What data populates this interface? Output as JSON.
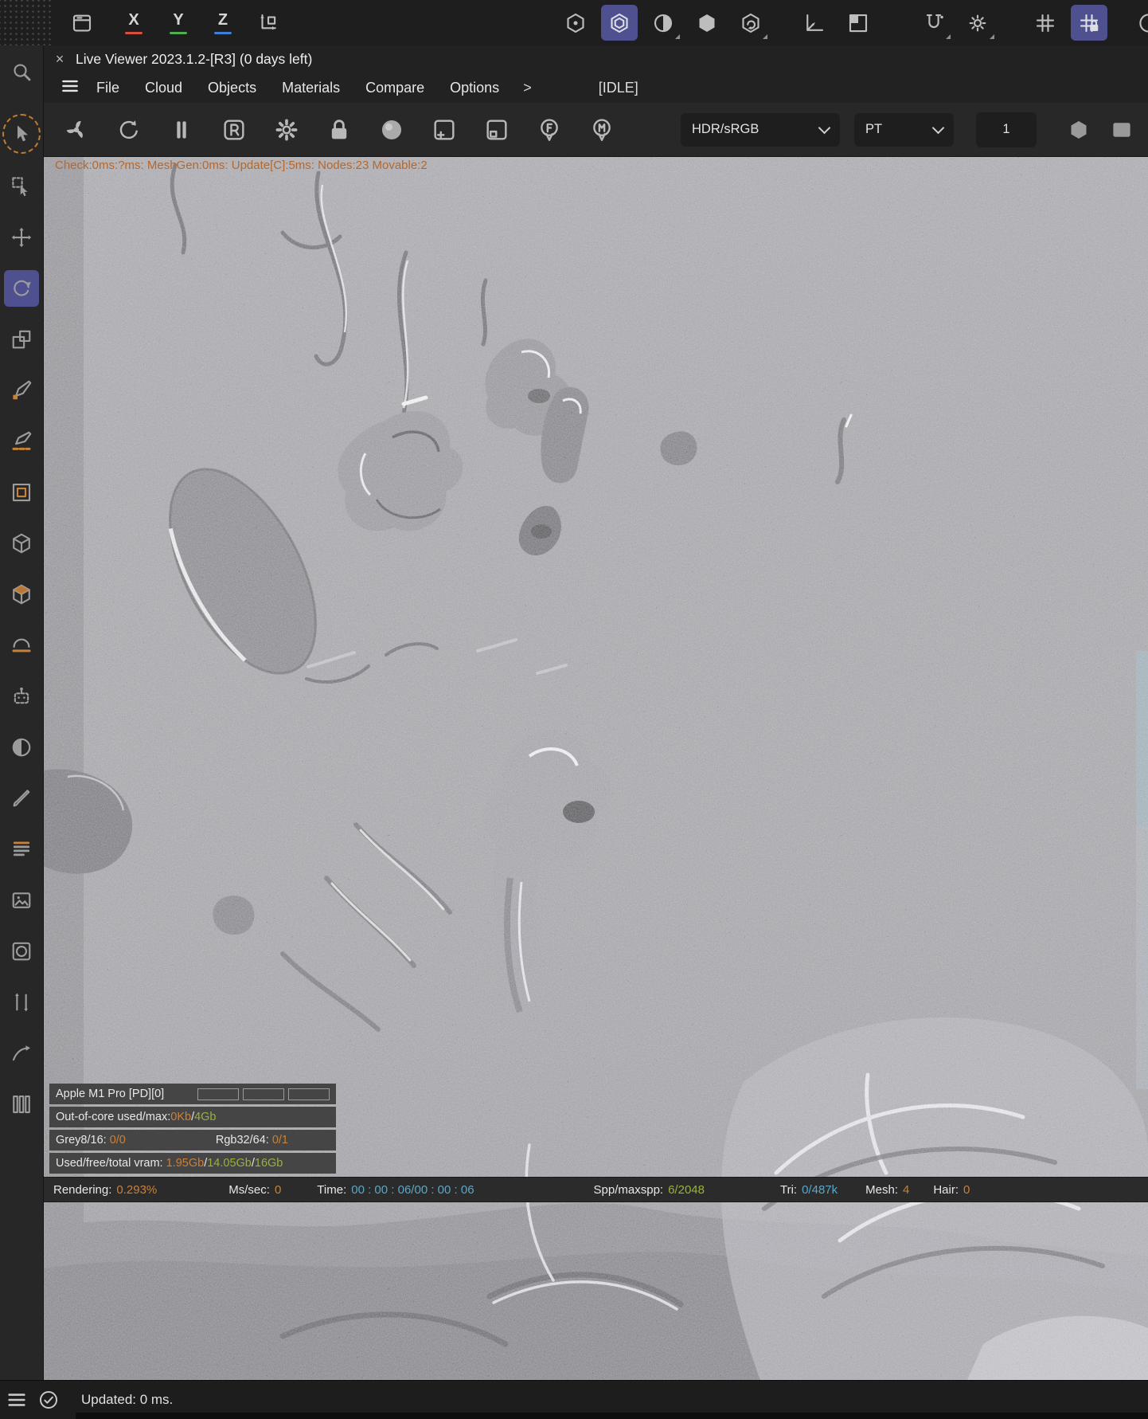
{
  "theme": {
    "accent_orange": "#c9813a",
    "accent_green": "#97b23c",
    "accent_blue": "#5aa7c9",
    "highlight_purple": "#4e508f",
    "axis_red": "#d94f3d",
    "axis_green": "#4fae4f",
    "axis_blue": "#3f7fd9",
    "viewport_base": "#87878e"
  },
  "window": {
    "close": "×",
    "title": "Live Viewer 2023.1.2-[R3] (0 days left)"
  },
  "top_toolbar": {
    "left_icons": [
      {
        "icon": "window",
        "name": "viewport-layout-icon"
      }
    ],
    "axis": [
      {
        "label": "X"
      },
      {
        "label": "Y"
      },
      {
        "label": "Z"
      }
    ],
    "gizmo_icons": [
      {
        "icon": "axis-gizmo",
        "name": "axis-gizmo-icon"
      }
    ],
    "mode_icons": [
      {
        "icon": "hex-dot",
        "name": "points-mode-icon"
      },
      {
        "icon": "hex-ring",
        "name": "edges-mode-icon",
        "active": true
      },
      {
        "icon": "sphere-half",
        "name": "polygons-mode-icon",
        "caret": true
      },
      {
        "icon": "hex-filled",
        "name": "object-mode-icon"
      },
      {
        "icon": "hex-instance",
        "name": "instance-mode-icon",
        "caret": true
      }
    ],
    "coord_icons": [
      {
        "icon": "corner-axis",
        "name": "workplane-icon"
      },
      {
        "icon": "quad-square",
        "name": "quantize-icon"
      }
    ],
    "snap_icons": [
      {
        "icon": "magnet",
        "name": "magnet-snap-icon",
        "caret": true
      },
      {
        "icon": "gear-snap",
        "name": "snap-settings-icon",
        "caret": true
      }
    ],
    "grid_icons": [
      {
        "icon": "grid",
        "name": "grid-icon"
      },
      {
        "icon": "grid-lock",
        "name": "grid-lock-icon",
        "active": true
      }
    ],
    "edge_icons": [
      {
        "icon": "circle-logo",
        "name": "partial-circle-icon"
      }
    ]
  },
  "menu": {
    "items": [
      "File",
      "Cloud",
      "Objects",
      "Materials",
      "Compare",
      "Options"
    ],
    "more": ">",
    "mode": "[IDLE]"
  },
  "render_toolbar": {
    "buttons": [
      {
        "icon": "turbine",
        "name": "restart-render-button"
      },
      {
        "icon": "refresh",
        "name": "refresh-render-button"
      },
      {
        "icon": "pause",
        "name": "pause-render-button"
      },
      {
        "icon": "r-badge",
        "name": "realtime-render-button"
      },
      {
        "icon": "gear",
        "name": "render-settings-button"
      },
      {
        "icon": "lock",
        "name": "lock-viewport-button"
      },
      {
        "icon": "ball",
        "name": "clay-mode-button"
      },
      {
        "icon": "region-add",
        "name": "add-render-region-button"
      },
      {
        "icon": "region-small",
        "name": "clear-render-region-button"
      },
      {
        "icon": "pin-f",
        "name": "focus-picker-button"
      },
      {
        "icon": "pin-m",
        "name": "material-picker-button"
      }
    ],
    "colorspace": "HDR/sRGB",
    "kernel": "PT",
    "passes": "1",
    "right_icons": [
      {
        "icon": "hex-filled",
        "name": "subsample-icon"
      },
      {
        "icon": "frame",
        "name": "viewport-frame-icon"
      }
    ]
  },
  "sidebar": {
    "tools": [
      {
        "icon": "search",
        "name": "search-tool"
      },
      {
        "icon": "cursor",
        "name": "select-tool",
        "ring": true
      },
      {
        "icon": "cursor-box",
        "name": "box-select-tool"
      },
      {
        "icon": "move",
        "name": "move-tool"
      },
      {
        "icon": "rotate",
        "name": "rotate-tool",
        "active": true
      },
      {
        "icon": "scale",
        "name": "scale-tool"
      },
      {
        "icon": "pen-pick",
        "name": "material-picker-tool"
      },
      {
        "icon": "pen-focus",
        "name": "focus-picker-tool"
      },
      {
        "icon": "region",
        "name": "render-region-tool"
      },
      {
        "icon": "cube",
        "name": "white-balance-tool"
      },
      {
        "icon": "cube-top",
        "name": "object-selection-tool"
      },
      {
        "icon": "arc",
        "name": "camera-target-tool"
      },
      {
        "icon": "bot",
        "name": "lock-camera-tool"
      },
      {
        "icon": "sphere",
        "name": "environment-tool"
      },
      {
        "icon": "brush",
        "name": "paint-tool"
      },
      {
        "icon": "rows",
        "name": "render-passes-tool"
      },
      {
        "icon": "photo",
        "name": "background-image-tool"
      },
      {
        "icon": "lens",
        "name": "lens-tool"
      },
      {
        "icon": "varrows",
        "name": "resolution-tool"
      },
      {
        "icon": "curve",
        "name": "response-curve-tool"
      },
      {
        "icon": "bars",
        "name": "histogram-tool"
      }
    ]
  },
  "viewport": {
    "debug": "Check:0ms:?ms: MeshGen:0ms: Update[C]:5ms: Nodes:23 Movable:2"
  },
  "device_panel": {
    "device": "Apple M1 Pro [PD][0]",
    "outofcore_label": "Out-of-core used/max:",
    "outofcore_used": "0Kb",
    "sep": "/",
    "outofcore_max": "4Gb",
    "grey_label": "Grey8/16:",
    "grey_value": "0/0",
    "rgb_label": "Rgb32/64:",
    "rgb_value": "0/1",
    "vram_label": "Used/free/total vram:",
    "vram_used": "1.95Gb",
    "vram_free": "14.05Gb",
    "vram_total": "16Gb"
  },
  "status_bar": {
    "rendering_label": "Rendering:",
    "rendering_value": "0.293%",
    "mssec_label": "Ms/sec:",
    "mssec_value": "0",
    "time_label": "Time:",
    "time_value": "00 : 00 : 06/00 : 00 : 06",
    "spp_label": "Spp/maxspp:",
    "spp_value": "6/2048",
    "tri_label": "Tri:",
    "tri_value": "0/487k",
    "mesh_label": "Mesh:",
    "mesh_value": "4",
    "hair_label": "Hair:",
    "hair_value": "0"
  },
  "footer": {
    "icons": [
      {
        "icon": "hamburger",
        "name": "footer-menu-icon"
      },
      {
        "icon": "check-circle",
        "name": "update-status-icon"
      }
    ],
    "updated": "Updated: 0 ms."
  }
}
